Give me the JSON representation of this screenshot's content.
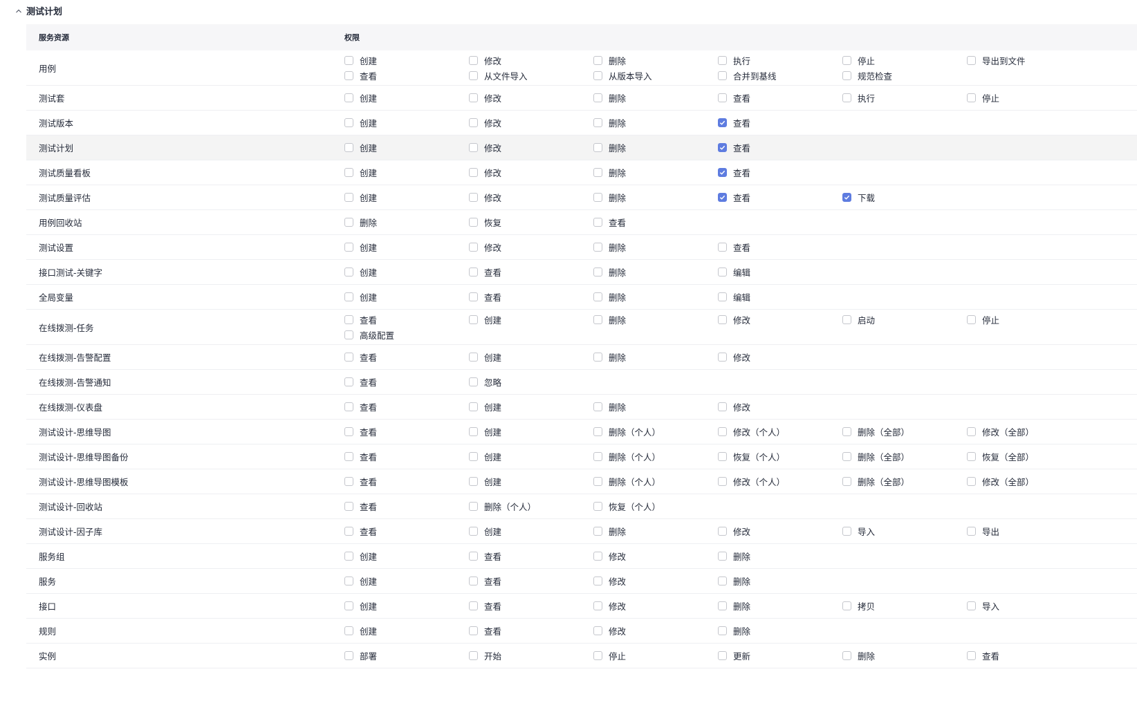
{
  "section": {
    "title": "测试计划",
    "icon": "chevron-up-icon"
  },
  "table": {
    "headers": {
      "resource": "服务资源",
      "permission": "权限"
    },
    "checkbox_color": "#5e7ce0",
    "rows": [
      {
        "name": "用例",
        "perms": [
          {
            "label": "创建",
            "checked": false
          },
          {
            "label": "修改",
            "checked": false
          },
          {
            "label": "删除",
            "checked": false
          },
          {
            "label": "执行",
            "checked": false
          },
          {
            "label": "停止",
            "checked": false
          },
          {
            "label": "导出到文件",
            "checked": false
          },
          {
            "label": "查看",
            "checked": false
          },
          {
            "label": "从文件导入",
            "checked": false
          },
          {
            "label": "从版本导入",
            "checked": false
          },
          {
            "label": "合并到基线",
            "checked": false
          },
          {
            "label": "规范检查",
            "checked": false
          }
        ]
      },
      {
        "name": "测试套",
        "perms": [
          {
            "label": "创建",
            "checked": false
          },
          {
            "label": "修改",
            "checked": false
          },
          {
            "label": "删除",
            "checked": false
          },
          {
            "label": "查看",
            "checked": false
          },
          {
            "label": "执行",
            "checked": false
          },
          {
            "label": "停止",
            "checked": false
          }
        ]
      },
      {
        "name": "测试版本",
        "perms": [
          {
            "label": "创建",
            "checked": false
          },
          {
            "label": "修改",
            "checked": false
          },
          {
            "label": "删除",
            "checked": false
          },
          {
            "label": "查看",
            "checked": true
          }
        ]
      },
      {
        "name": "测试计划",
        "highlight": true,
        "perms": [
          {
            "label": "创建",
            "checked": false
          },
          {
            "label": "修改",
            "checked": false
          },
          {
            "label": "删除",
            "checked": false
          },
          {
            "label": "查看",
            "checked": true
          }
        ]
      },
      {
        "name": "测试质量看板",
        "perms": [
          {
            "label": "创建",
            "checked": false
          },
          {
            "label": "修改",
            "checked": false
          },
          {
            "label": "删除",
            "checked": false
          },
          {
            "label": "查看",
            "checked": true
          }
        ]
      },
      {
        "name": "测试质量评估",
        "perms": [
          {
            "label": "创建",
            "checked": false
          },
          {
            "label": "修改",
            "checked": false
          },
          {
            "label": "删除",
            "checked": false
          },
          {
            "label": "查看",
            "checked": true
          },
          {
            "label": "下载",
            "checked": true
          }
        ]
      },
      {
        "name": "用例回收站",
        "perms": [
          {
            "label": "删除",
            "checked": false
          },
          {
            "label": "恢复",
            "checked": false
          },
          {
            "label": "查看",
            "checked": false
          }
        ]
      },
      {
        "name": "测试设置",
        "perms": [
          {
            "label": "创建",
            "checked": false
          },
          {
            "label": "修改",
            "checked": false
          },
          {
            "label": "删除",
            "checked": false
          },
          {
            "label": "查看",
            "checked": false
          }
        ]
      },
      {
        "name": "接口测试-关键字",
        "perms": [
          {
            "label": "创建",
            "checked": false
          },
          {
            "label": "查看",
            "checked": false
          },
          {
            "label": "删除",
            "checked": false
          },
          {
            "label": "编辑",
            "checked": false
          }
        ]
      },
      {
        "name": "全局变量",
        "perms": [
          {
            "label": "创建",
            "checked": false
          },
          {
            "label": "查看",
            "checked": false
          },
          {
            "label": "删除",
            "checked": false
          },
          {
            "label": "编辑",
            "checked": false
          }
        ]
      },
      {
        "name": "在线拨测-任务",
        "perms": [
          {
            "label": "查看",
            "checked": false
          },
          {
            "label": "创建",
            "checked": false
          },
          {
            "label": "删除",
            "checked": false
          },
          {
            "label": "修改",
            "checked": false
          },
          {
            "label": "启动",
            "checked": false
          },
          {
            "label": "停止",
            "checked": false
          },
          {
            "label": "高级配置",
            "checked": false
          }
        ]
      },
      {
        "name": "在线拨测-告警配置",
        "perms": [
          {
            "label": "查看",
            "checked": false
          },
          {
            "label": "创建",
            "checked": false
          },
          {
            "label": "删除",
            "checked": false
          },
          {
            "label": "修改",
            "checked": false
          }
        ]
      },
      {
        "name": "在线拨测-告警通知",
        "perms": [
          {
            "label": "查看",
            "checked": false
          },
          {
            "label": "忽略",
            "checked": false
          }
        ]
      },
      {
        "name": "在线拨测-仪表盘",
        "perms": [
          {
            "label": "查看",
            "checked": false
          },
          {
            "label": "创建",
            "checked": false
          },
          {
            "label": "删除",
            "checked": false
          },
          {
            "label": "修改",
            "checked": false
          }
        ]
      },
      {
        "name": "测试设计-思维导图",
        "perms": [
          {
            "label": "查看",
            "checked": false
          },
          {
            "label": "创建",
            "checked": false
          },
          {
            "label": "删除（个人）",
            "checked": false
          },
          {
            "label": "修改（个人）",
            "checked": false
          },
          {
            "label": "删除（全部）",
            "checked": false
          },
          {
            "label": "修改（全部）",
            "checked": false
          }
        ]
      },
      {
        "name": "测试设计-思维导图备份",
        "perms": [
          {
            "label": "查看",
            "checked": false
          },
          {
            "label": "创建",
            "checked": false
          },
          {
            "label": "删除（个人）",
            "checked": false
          },
          {
            "label": "恢复（个人）",
            "checked": false
          },
          {
            "label": "删除（全部）",
            "checked": false
          },
          {
            "label": "恢复（全部）",
            "checked": false
          }
        ]
      },
      {
        "name": "测试设计-思维导图模板",
        "perms": [
          {
            "label": "查看",
            "checked": false
          },
          {
            "label": "创建",
            "checked": false
          },
          {
            "label": "删除（个人）",
            "checked": false
          },
          {
            "label": "修改（个人）",
            "checked": false
          },
          {
            "label": "删除（全部）",
            "checked": false
          },
          {
            "label": "修改（全部）",
            "checked": false
          }
        ]
      },
      {
        "name": "测试设计-回收站",
        "perms": [
          {
            "label": "查看",
            "checked": false
          },
          {
            "label": "删除（个人）",
            "checked": false
          },
          {
            "label": "恢复（个人）",
            "checked": false
          }
        ]
      },
      {
        "name": "测试设计-因子库",
        "perms": [
          {
            "label": "查看",
            "checked": false
          },
          {
            "label": "创建",
            "checked": false
          },
          {
            "label": "删除",
            "checked": false
          },
          {
            "label": "修改",
            "checked": false
          },
          {
            "label": "导入",
            "checked": false
          },
          {
            "label": "导出",
            "checked": false
          }
        ]
      },
      {
        "name": "服务组",
        "perms": [
          {
            "label": "创建",
            "checked": false
          },
          {
            "label": "查看",
            "checked": false
          },
          {
            "label": "修改",
            "checked": false
          },
          {
            "label": "删除",
            "checked": false
          }
        ]
      },
      {
        "name": "服务",
        "perms": [
          {
            "label": "创建",
            "checked": false
          },
          {
            "label": "查看",
            "checked": false
          },
          {
            "label": "修改",
            "checked": false
          },
          {
            "label": "删除",
            "checked": false
          }
        ]
      },
      {
        "name": "接口",
        "perms": [
          {
            "label": "创建",
            "checked": false
          },
          {
            "label": "查看",
            "checked": false
          },
          {
            "label": "修改",
            "checked": false
          },
          {
            "label": "删除",
            "checked": false
          },
          {
            "label": "拷贝",
            "checked": false
          },
          {
            "label": "导入",
            "checked": false
          }
        ]
      },
      {
        "name": "规则",
        "perms": [
          {
            "label": "创建",
            "checked": false
          },
          {
            "label": "查看",
            "checked": false
          },
          {
            "label": "修改",
            "checked": false
          },
          {
            "label": "删除",
            "checked": false
          }
        ]
      },
      {
        "name": "实例",
        "perms": [
          {
            "label": "部署",
            "checked": false
          },
          {
            "label": "开始",
            "checked": false
          },
          {
            "label": "停止",
            "checked": false
          },
          {
            "label": "更新",
            "checked": false
          },
          {
            "label": "删除",
            "checked": false
          },
          {
            "label": "查看",
            "checked": false
          }
        ]
      }
    ]
  }
}
